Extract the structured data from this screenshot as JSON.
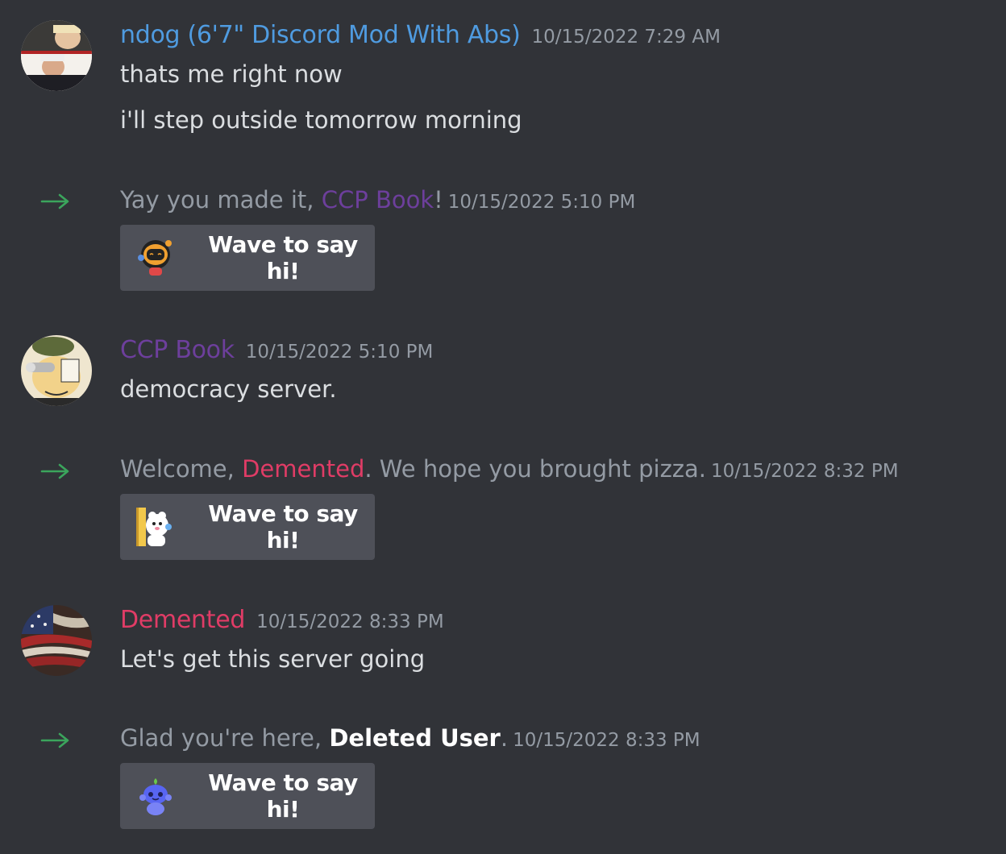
{
  "colors": {
    "background": "#313338",
    "ndog": "#4f9be0",
    "ccp_book": "#6d3f9c",
    "demented": "#e03c66",
    "arrow": "#3ba55c",
    "button": "#4e5058"
  },
  "messages": [
    {
      "username": "ndog (6'7\" Discord Mod With Abs)",
      "timestamp": "10/15/2022 7:29 AM",
      "lines": [
        "thats me right now",
        "i'll step outside tomorrow morning"
      ]
    },
    {
      "username": "CCP Book",
      "timestamp": "10/15/2022 5:10 PM",
      "lines": [
        "democracy server."
      ]
    },
    {
      "username": "Demented",
      "timestamp": "10/15/2022 8:33 PM",
      "lines": [
        "Let's get this server going"
      ]
    }
  ],
  "joins": [
    {
      "prefix": "Yay you made it, ",
      "user": "CCP Book",
      "suffix": "!",
      "timestamp": "10/15/2022 5:10 PM",
      "button": "Wave to say hi!",
      "sticker_icon": "robot-wave-icon"
    },
    {
      "prefix": "Welcome, ",
      "user": "Demented",
      "suffix": ". We hope you brought pizza.",
      "timestamp": "10/15/2022 8:32 PM",
      "button": "Wave to say hi!",
      "sticker_icon": "bear-peek-icon"
    },
    {
      "prefix": "Glad you're here, ",
      "user": "Deleted User",
      "suffix": ".",
      "timestamp": "10/15/2022 8:33 PM",
      "button": "Wave to say hi!",
      "sticker_icon": "wumpus-wave-icon"
    }
  ]
}
